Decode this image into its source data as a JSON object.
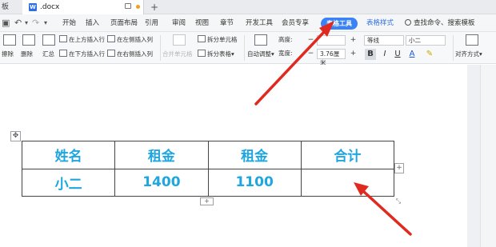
{
  "titlebar": {
    "prev_tab": "板",
    "doc_icon": "W",
    "doc_name": ".docx",
    "add_tab": "+"
  },
  "menubar": {
    "items": [
      "开始",
      "插入",
      "页面布局",
      "引用",
      "审阅",
      "视图",
      "章节",
      "开发工具",
      "会员专享"
    ],
    "table_tools": "表格工具",
    "table_style": "表格样式",
    "search": "查找命令、搜索模板"
  },
  "ribbon": {
    "eraser": "擦除",
    "delete": "删除",
    "summary": "汇总",
    "insert_row_above": "在上方插入行",
    "insert_row_below": "在下方插入行",
    "insert_col_left": "在左侧插入列",
    "insert_col_right": "在右侧插入列",
    "merge_cells": "合并单元格",
    "split_cells": "拆分单元格",
    "split_table": "拆分表格",
    "autofit": "自动调整",
    "height_label": "高度:",
    "width_label": "宽度:",
    "width_value": "3.76厘米",
    "font_name": "等线",
    "font_size": "小二",
    "align": "对齐方式"
  },
  "table": {
    "header": [
      "姓名",
      "租金",
      "租金",
      "合计"
    ],
    "rows": [
      [
        "小二",
        "1400",
        "1100",
        ""
      ]
    ]
  },
  "colors": {
    "cell_text": "#1ea6e0",
    "accent": "#3b82f6",
    "arrow": "#e02a20"
  }
}
